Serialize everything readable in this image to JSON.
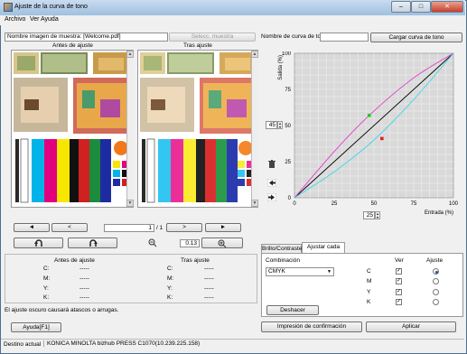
{
  "window": {
    "title": "Ajuste de la curva de tono",
    "min_label": "–",
    "max_label": "□",
    "close_label": "✕"
  },
  "menu": [
    "Archivo",
    "Ver",
    "Ayuda"
  ],
  "sample": {
    "label": "Nombre imagen de muestra",
    "value": "Nombre imagen de muestra: [Welcome.pdf]",
    "select_button": "Selecc. muestra",
    "before_label": "Antes de ajuste",
    "after_label": "Tras ajuste"
  },
  "curve_name": {
    "label": "Nombre de curva de tono",
    "value": "",
    "load_button": "Cargar curva de tono"
  },
  "nav": {
    "first": "◄",
    "prev": "<",
    "page_value": "1",
    "page_total": "/ 1",
    "next": ">",
    "last": "►",
    "zoom_value": "0.13"
  },
  "info": {
    "before_header": "Antes de ajuste",
    "after_header": "Tras ajuste",
    "rows": [
      {
        "label": "C:",
        "before": "-----",
        "after": "-----"
      },
      {
        "label": "M:",
        "before": "-----",
        "after": "-----"
      },
      {
        "label": "Y:",
        "before": "-----",
        "after": "-----"
      },
      {
        "label": "K:",
        "before": "-----",
        "after": "-----"
      }
    ],
    "warning": "El ajuste oscuro causará atascos o arrugas."
  },
  "help_button": "Ayuda[F1]",
  "chart_data": {
    "type": "line",
    "title": "",
    "xlabel": "Entrada (%)",
    "ylabel": "Salida (%)",
    "xlim": [
      0,
      100
    ],
    "ylim": [
      0,
      100
    ],
    "x_ticks": [
      0,
      25,
      50,
      75,
      100
    ],
    "y_ticks": [
      0,
      25,
      50,
      75,
      100
    ],
    "grid": true,
    "series": [
      {
        "color": "#000000",
        "x": [
          0,
          100
        ],
        "y": [
          0,
          100
        ]
      },
      {
        "color": "#e23ad0",
        "x": [
          0,
          25,
          47,
          75,
          100
        ],
        "y": [
          0,
          32,
          57,
          83,
          100
        ]
      },
      {
        "color": "#42d4e8",
        "x": [
          0,
          25,
          50,
          75,
          100
        ],
        "y": [
          0,
          18,
          40,
          68,
          100
        ]
      }
    ],
    "points": [
      {
        "x": 47,
        "y": 57,
        "color": "#22c722"
      },
      {
        "x": 55,
        "y": 41,
        "color": "#e02020"
      }
    ],
    "x_spin_value": "25",
    "y_spin_value": "45"
  },
  "tabs": {
    "tab1": "Brillo/Contraste",
    "tab2": "Ajustar cada color"
  },
  "color_adjust": {
    "combination_label": "Combinación",
    "combination_value": "CMYK",
    "ver_header": "Ver",
    "ajuste_header": "Ajuste",
    "colors": [
      {
        "name": "C",
        "view": true,
        "selected": true
      },
      {
        "name": "M",
        "view": true,
        "selected": false
      },
      {
        "name": "Y",
        "view": true,
        "selected": false
      },
      {
        "name": "K",
        "view": true,
        "selected": false
      }
    ],
    "undo_button": "Deshacer"
  },
  "bottom": {
    "print_confirm": "Impresión de confirmación",
    "apply": "Aplicar"
  },
  "status": {
    "label": "Destino actual",
    "value": "KONICA MINOLTA bizhub PRESS C1070(10.239.225.158)"
  },
  "icons": {
    "trash": "🗑",
    "nudge_left": "◂",
    "nudge_right": "▸",
    "zoom_out": "−",
    "zoom_in": "+"
  }
}
